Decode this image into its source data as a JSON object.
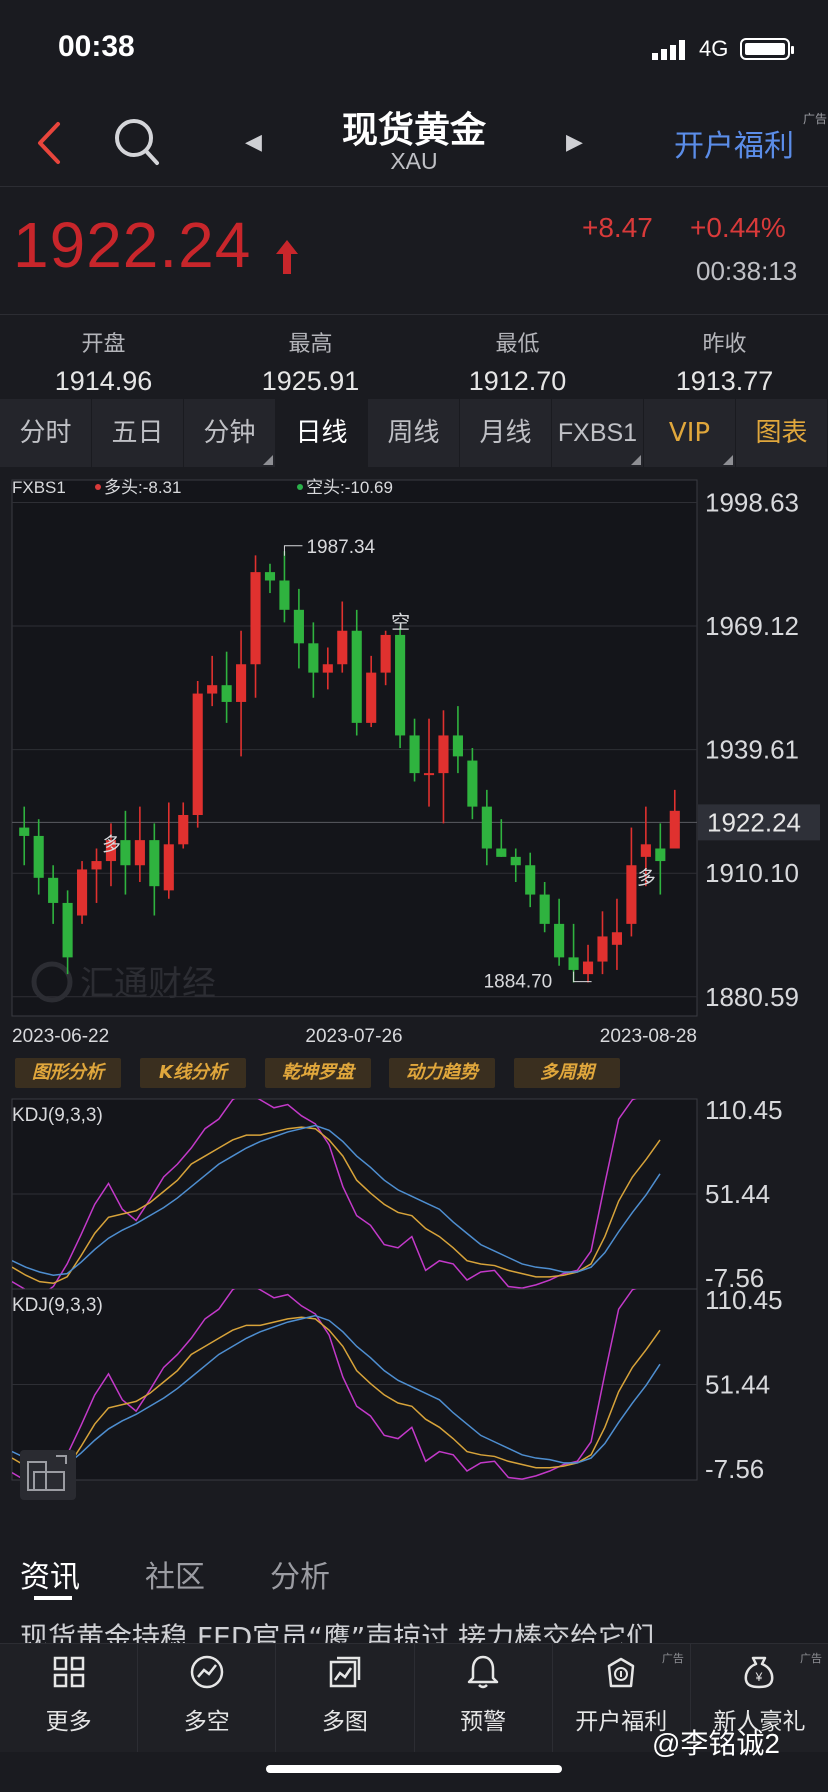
{
  "status_bar": {
    "time": "00:38",
    "network": "4G"
  },
  "header": {
    "title": "现货黄金",
    "subtitle": "XAU",
    "welfare_label": "开户福利",
    "ad_tag": "广告"
  },
  "quote": {
    "price": "1922.24",
    "change": "+8.47",
    "change_pct": "+0.44%",
    "time": "00:38:13",
    "price_color": "#c8262b"
  },
  "stats": [
    {
      "label": "开盘",
      "value": "1914.96"
    },
    {
      "label": "最高",
      "value": "1925.91"
    },
    {
      "label": "最低",
      "value": "1912.70"
    },
    {
      "label": "昨收",
      "value": "1913.77"
    }
  ],
  "tabs": [
    "分时",
    "五日",
    "分钟",
    "日线",
    "周线",
    "月线",
    "FXBS1",
    "VIP",
    "图表"
  ],
  "active_tab": "日线",
  "chart_data": [
    {
      "type": "candlestick",
      "indicator_label": "FXBS1",
      "legend": [
        {
          "name": "多头",
          "value": "-8.31",
          "color": "#d93a3a"
        },
        {
          "name": "空头",
          "value": "-10.69",
          "color": "#2ab04a"
        }
      ],
      "y_ticks": [
        "1998.63",
        "1969.12",
        "1939.61",
        "1910.10",
        "1880.59"
      ],
      "ylim": [
        1876,
        2004
      ],
      "current_price_label": "1922.24",
      "current_price": 1922.24,
      "high_annotation": {
        "label": "1987.34",
        "value": 1987.34
      },
      "low_annotation": {
        "label": "1884.70",
        "value": 1884.7
      },
      "x_ticks": [
        "2023-06-22",
        "2023-07-26",
        "2023-08-28"
      ],
      "signals": [
        {
          "text": "多",
          "index": 6,
          "value": 1917
        },
        {
          "text": "空",
          "index": 26,
          "value": 1970
        },
        {
          "text": "多",
          "index": 43,
          "value": 1909
        }
      ],
      "watermark": "汇通财经",
      "candles": [
        [
          1921,
          1919,
          1926,
          1912
        ],
        [
          1919,
          1909,
          1923,
          1905
        ],
        [
          1909,
          1903,
          1912,
          1898
        ],
        [
          1903,
          1890,
          1906,
          1886
        ],
        [
          1900,
          1911,
          1913,
          1898
        ],
        [
          1911,
          1913,
          1916,
          1903
        ],
        [
          1913,
          1918,
          1922,
          1907
        ],
        [
          1918,
          1912,
          1925,
          1905
        ],
        [
          1912,
          1918,
          1926,
          1908
        ],
        [
          1918,
          1907,
          1922,
          1900
        ],
        [
          1906,
          1917,
          1927,
          1904
        ],
        [
          1917,
          1924,
          1927,
          1916
        ],
        [
          1924,
          1953,
          1956,
          1921
        ],
        [
          1953,
          1955,
          1962,
          1950
        ],
        [
          1955,
          1951,
          1963,
          1946
        ],
        [
          1951,
          1960,
          1968,
          1938
        ],
        [
          1960,
          1982,
          1986,
          1952
        ],
        [
          1982,
          1980,
          1984,
          1977
        ],
        [
          1980,
          1973,
          1987,
          1970
        ],
        [
          1973,
          1965,
          1978,
          1959
        ],
        [
          1965,
          1958,
          1970,
          1952
        ],
        [
          1958,
          1960,
          1964,
          1954
        ],
        [
          1960,
          1968,
          1975,
          1958
        ],
        [
          1968,
          1946,
          1973,
          1943
        ],
        [
          1946,
          1958,
          1962,
          1945
        ],
        [
          1958,
          1967,
          1968,
          1955
        ],
        [
          1967,
          1943,
          1969,
          1940
        ],
        [
          1943,
          1934,
          1947,
          1932
        ],
        [
          1934,
          1934,
          1947,
          1926
        ],
        [
          1934,
          1943,
          1949,
          1922
        ],
        [
          1943,
          1938,
          1950,
          1934
        ],
        [
          1937,
          1926,
          1940,
          1923
        ],
        [
          1926,
          1916,
          1930,
          1912
        ],
        [
          1916,
          1914,
          1923,
          1914
        ],
        [
          1914,
          1912,
          1916,
          1908
        ],
        [
          1912,
          1905,
          1915,
          1902
        ],
        [
          1905,
          1898,
          1908,
          1896
        ],
        [
          1898,
          1890,
          1904,
          1888
        ],
        [
          1890,
          1887,
          1898,
          1884
        ],
        [
          1886,
          1889,
          1893,
          1884
        ],
        [
          1889,
          1895,
          1901,
          1886
        ],
        [
          1893,
          1896,
          1904,
          1887
        ],
        [
          1898,
          1912,
          1921,
          1895
        ],
        [
          1914,
          1917,
          1926,
          1907
        ],
        [
          1916,
          1913,
          1922,
          1905
        ],
        [
          1916,
          1925,
          1930,
          1916
        ]
      ]
    },
    {
      "type": "line",
      "label": "KDJ(9,3,3)",
      "y_ticks": [
        "110.45",
        "51.44",
        "-7.56"
      ],
      "ylim": [
        -7.56,
        110.45
      ],
      "series": [
        {
          "color": "#c339c9",
          "values": [
            -3,
            -8,
            -12,
            -6,
            8,
            26,
            45,
            58,
            42,
            35,
            48,
            62,
            70,
            80,
            92,
            98,
            110,
            115,
            110,
            105,
            107,
            100,
            95,
            82,
            56,
            38,
            32,
            20,
            18,
            25,
            4,
            10,
            8,
            -2,
            3,
            4,
            -6,
            -7,
            -5,
            -2,
            2,
            4,
            16,
            58,
            98,
            110,
            113,
            120
          ]
        },
        {
          "color": "#d7a33a",
          "values": [
            6,
            1,
            -3,
            -4,
            0,
            13,
            27,
            37,
            39,
            41,
            46,
            53,
            60,
            70,
            75,
            80,
            85,
            88,
            88,
            90,
            92,
            93,
            92,
            85,
            75,
            60,
            52,
            45,
            40,
            38,
            30,
            25,
            18,
            10,
            8,
            7,
            4,
            2,
            0,
            0,
            1,
            3,
            8,
            25,
            47,
            62,
            73,
            85
          ]
        },
        {
          "color": "#4e8ed0",
          "values": [
            10,
            6,
            3,
            1,
            2,
            9,
            17,
            24,
            29,
            33,
            38,
            43,
            49,
            56,
            63,
            70,
            75,
            80,
            84,
            87,
            90,
            92,
            94,
            91,
            84,
            75,
            68,
            60,
            54,
            50,
            46,
            42,
            34,
            27,
            20,
            16,
            12,
            8,
            6,
            5,
            3,
            3,
            6,
            15,
            28,
            40,
            51,
            64
          ]
        }
      ]
    },
    {
      "type": "line",
      "label": "KDJ(9,3,3)",
      "y_ticks": [
        "110.45",
        "51.44",
        "-7.56"
      ],
      "ylim": [
        -7.56,
        110.45
      ]
    }
  ],
  "analysis_buttons": [
    "图形分析",
    "K线分析",
    "乾坤罗盘",
    "动力趋势",
    "多周期"
  ],
  "news": {
    "tabs": [
      "资讯",
      "社区",
      "分析"
    ],
    "active": "资讯",
    "headline": "现货黄金持稳   FED官员“鹰”声掠过   接力棒交给它们"
  },
  "bottom_nav": [
    {
      "label": "更多",
      "icon": "grid-icon"
    },
    {
      "label": "多空",
      "icon": "trend-circle-icon"
    },
    {
      "label": "多图",
      "icon": "multi-chart-icon"
    },
    {
      "label": "预警",
      "icon": "bell-icon"
    },
    {
      "label": "开户福利",
      "icon": "gift-bag-icon",
      "ad": "广告"
    },
    {
      "label": "新人豪礼",
      "icon": "money-bag-icon",
      "ad": "广告"
    }
  ],
  "watermark": "@李铭诚2"
}
